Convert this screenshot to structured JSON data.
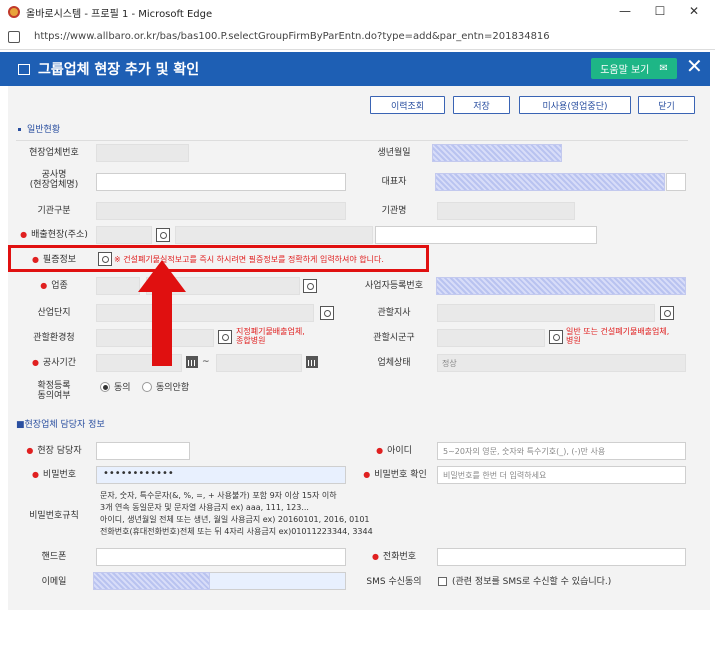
{
  "browser": {
    "title": "올바로시스템 - 프로필 1 - Microsoft Edge",
    "url": "https://www.allbaro.or.kr/bas/bas100.P.selectGroupFirmByParEntn.do?type=add&par_entn=201834816",
    "minimize": "—",
    "maximize": "☐",
    "close": "✕",
    "read_aloud": "Aᵃ",
    "zoom_icon": "⌕"
  },
  "header": {
    "title": "그룹업체 현장 추가 및 확인",
    "help_label": "도움말 보기",
    "help_icon": "✉",
    "close_label": "✕"
  },
  "toolbar": {
    "history": "이력조회",
    "save": "저장",
    "unused": "미사용(영업중단)",
    "close": "닫기"
  },
  "sections": {
    "general": "일반현황",
    "contact": "■현장업체 담당자 정보"
  },
  "labels": {
    "site_number": "현장업체번호",
    "birth": "생년월일",
    "project_name_1": "공사명",
    "project_name_2": "(현장업체명)",
    "representative": "대표자",
    "agency_type": "기관구분",
    "agency_name": "기관명",
    "discharge_site": "배출현장(주소)",
    "license_info": "필증정보",
    "business_type": "업종",
    "business_reg": "사업자등록번호",
    "industrial_complex": "산업단지",
    "branch": "관할지사",
    "env_office": "관할환경청",
    "district": "관할시군구",
    "period": "공사기간",
    "status": "업체상태",
    "consent_1": "확정등록",
    "consent_2": "동의여부",
    "manager": "현장 담당자",
    "user_id": "아이디",
    "password": "비밀번호",
    "password_confirm": "비밀번호 확인",
    "password_rules": "비밀번호규칙",
    "mobile": "핸드폰",
    "phone": "전화번호",
    "email": "이메일",
    "sms": "SMS 수신동의"
  },
  "values": {
    "status": "정상",
    "password_mask": "••••••••••••",
    "period_sep": "~",
    "agree": "동의",
    "disagree": "동의안함",
    "sms_text": "(관련 정보를 SMS로 수신할 수 있습니다.)"
  },
  "placeholders": {
    "user_id": "5~20자의 영문, 숫자와 특수기호(_), (-)만 사용",
    "password_confirm": "비밀번호를 한번 더 입력하세요"
  },
  "notes": {
    "license": "※ 건설폐기물실적보고를 즉시 하시려면 필증정보를 정확하게 입력하셔야 합니다.",
    "env_office_1": "지정폐기물배출업체,",
    "env_office_2": "종합병원",
    "district_1": "일반 또는 건설폐기물배출업체,",
    "district_2": "병원"
  },
  "password_rules": [
    "문자, 숫자, 특수문자(&, %, =, + 사용불가) 포함 9자 이상 15자 이하",
    "3개 연속 동일문자 및 문자열 사용금지 ex) aaa, 111, 123...",
    "아이디, 생년월일 전체 또는 생년, 월일 사용금지 ex) 20160101, 2016, 0101",
    "전화번호(휴대전화번호)전체 또는 뒤 4자리 사용금지 ex)01011223344, 3344"
  ],
  "colors": {
    "header": "#1e5fb4",
    "help": "#1eb686",
    "required": "#e02020",
    "annotation": "#e01010"
  }
}
